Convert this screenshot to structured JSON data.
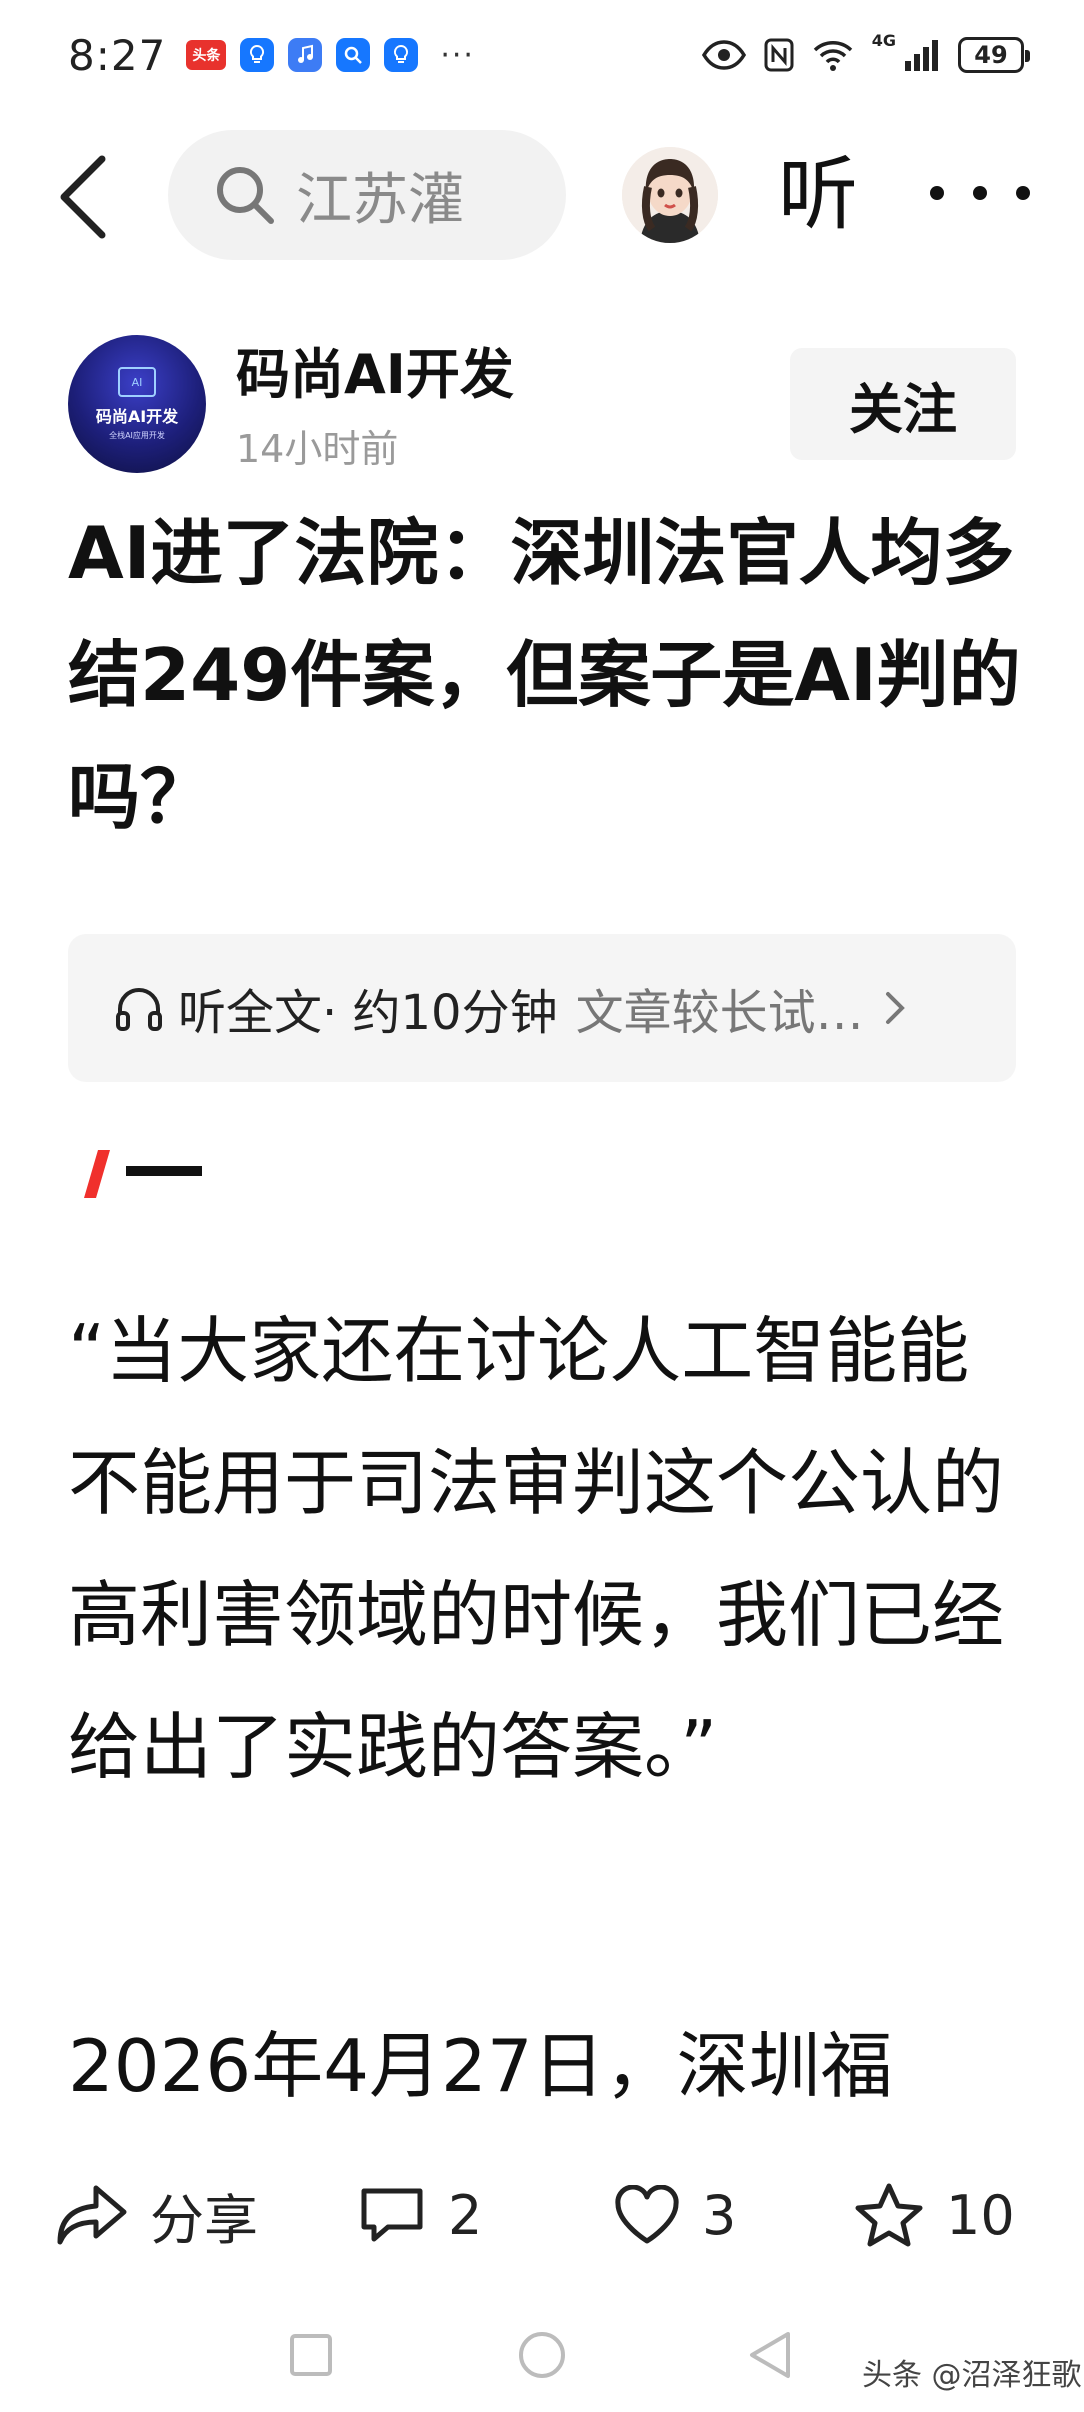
{
  "status_bar": {
    "time": "8:27",
    "app_badges": [
      "头条"
    ],
    "more": "···",
    "signal_label": "4G",
    "battery": "49"
  },
  "nav": {
    "search_text": "江苏灌",
    "listen_label": "听"
  },
  "author": {
    "name": "码尚AI开发",
    "time": "14小时前",
    "follow_label": "关注",
    "logo_title": "码尚AI开发",
    "logo_sub": "全栈AI应用开发"
  },
  "article": {
    "title": "AI进了法院：深圳法官人均多结249件案，但案子是AI判的吗？",
    "listen_bar": {
      "label": "听全文· 约10分钟",
      "hint": "文章较长试…"
    },
    "paragraph_1": "“当大家还在讨论人工智能能不能用于司法审判这个公认的高利害领域的时候，我们已经给出了实践的答案。”",
    "paragraph_2": "2026年4月27日，深圳福"
  },
  "actions": {
    "share_label": "分享",
    "comment_count": "2",
    "like_count": "3",
    "favorite_count": "10"
  },
  "watermark": "头条 @沼泽狂歌",
  "colors": {
    "accent_red": "#f0302c",
    "text": "#111111",
    "muted": "#9a9a9a",
    "chip_bg": "#f4f4f4"
  },
  "icons": [
    "back-icon",
    "search-icon",
    "headphones-icon",
    "chevron-right-icon",
    "share-icon",
    "comment-icon",
    "heart-icon",
    "star-icon"
  ]
}
